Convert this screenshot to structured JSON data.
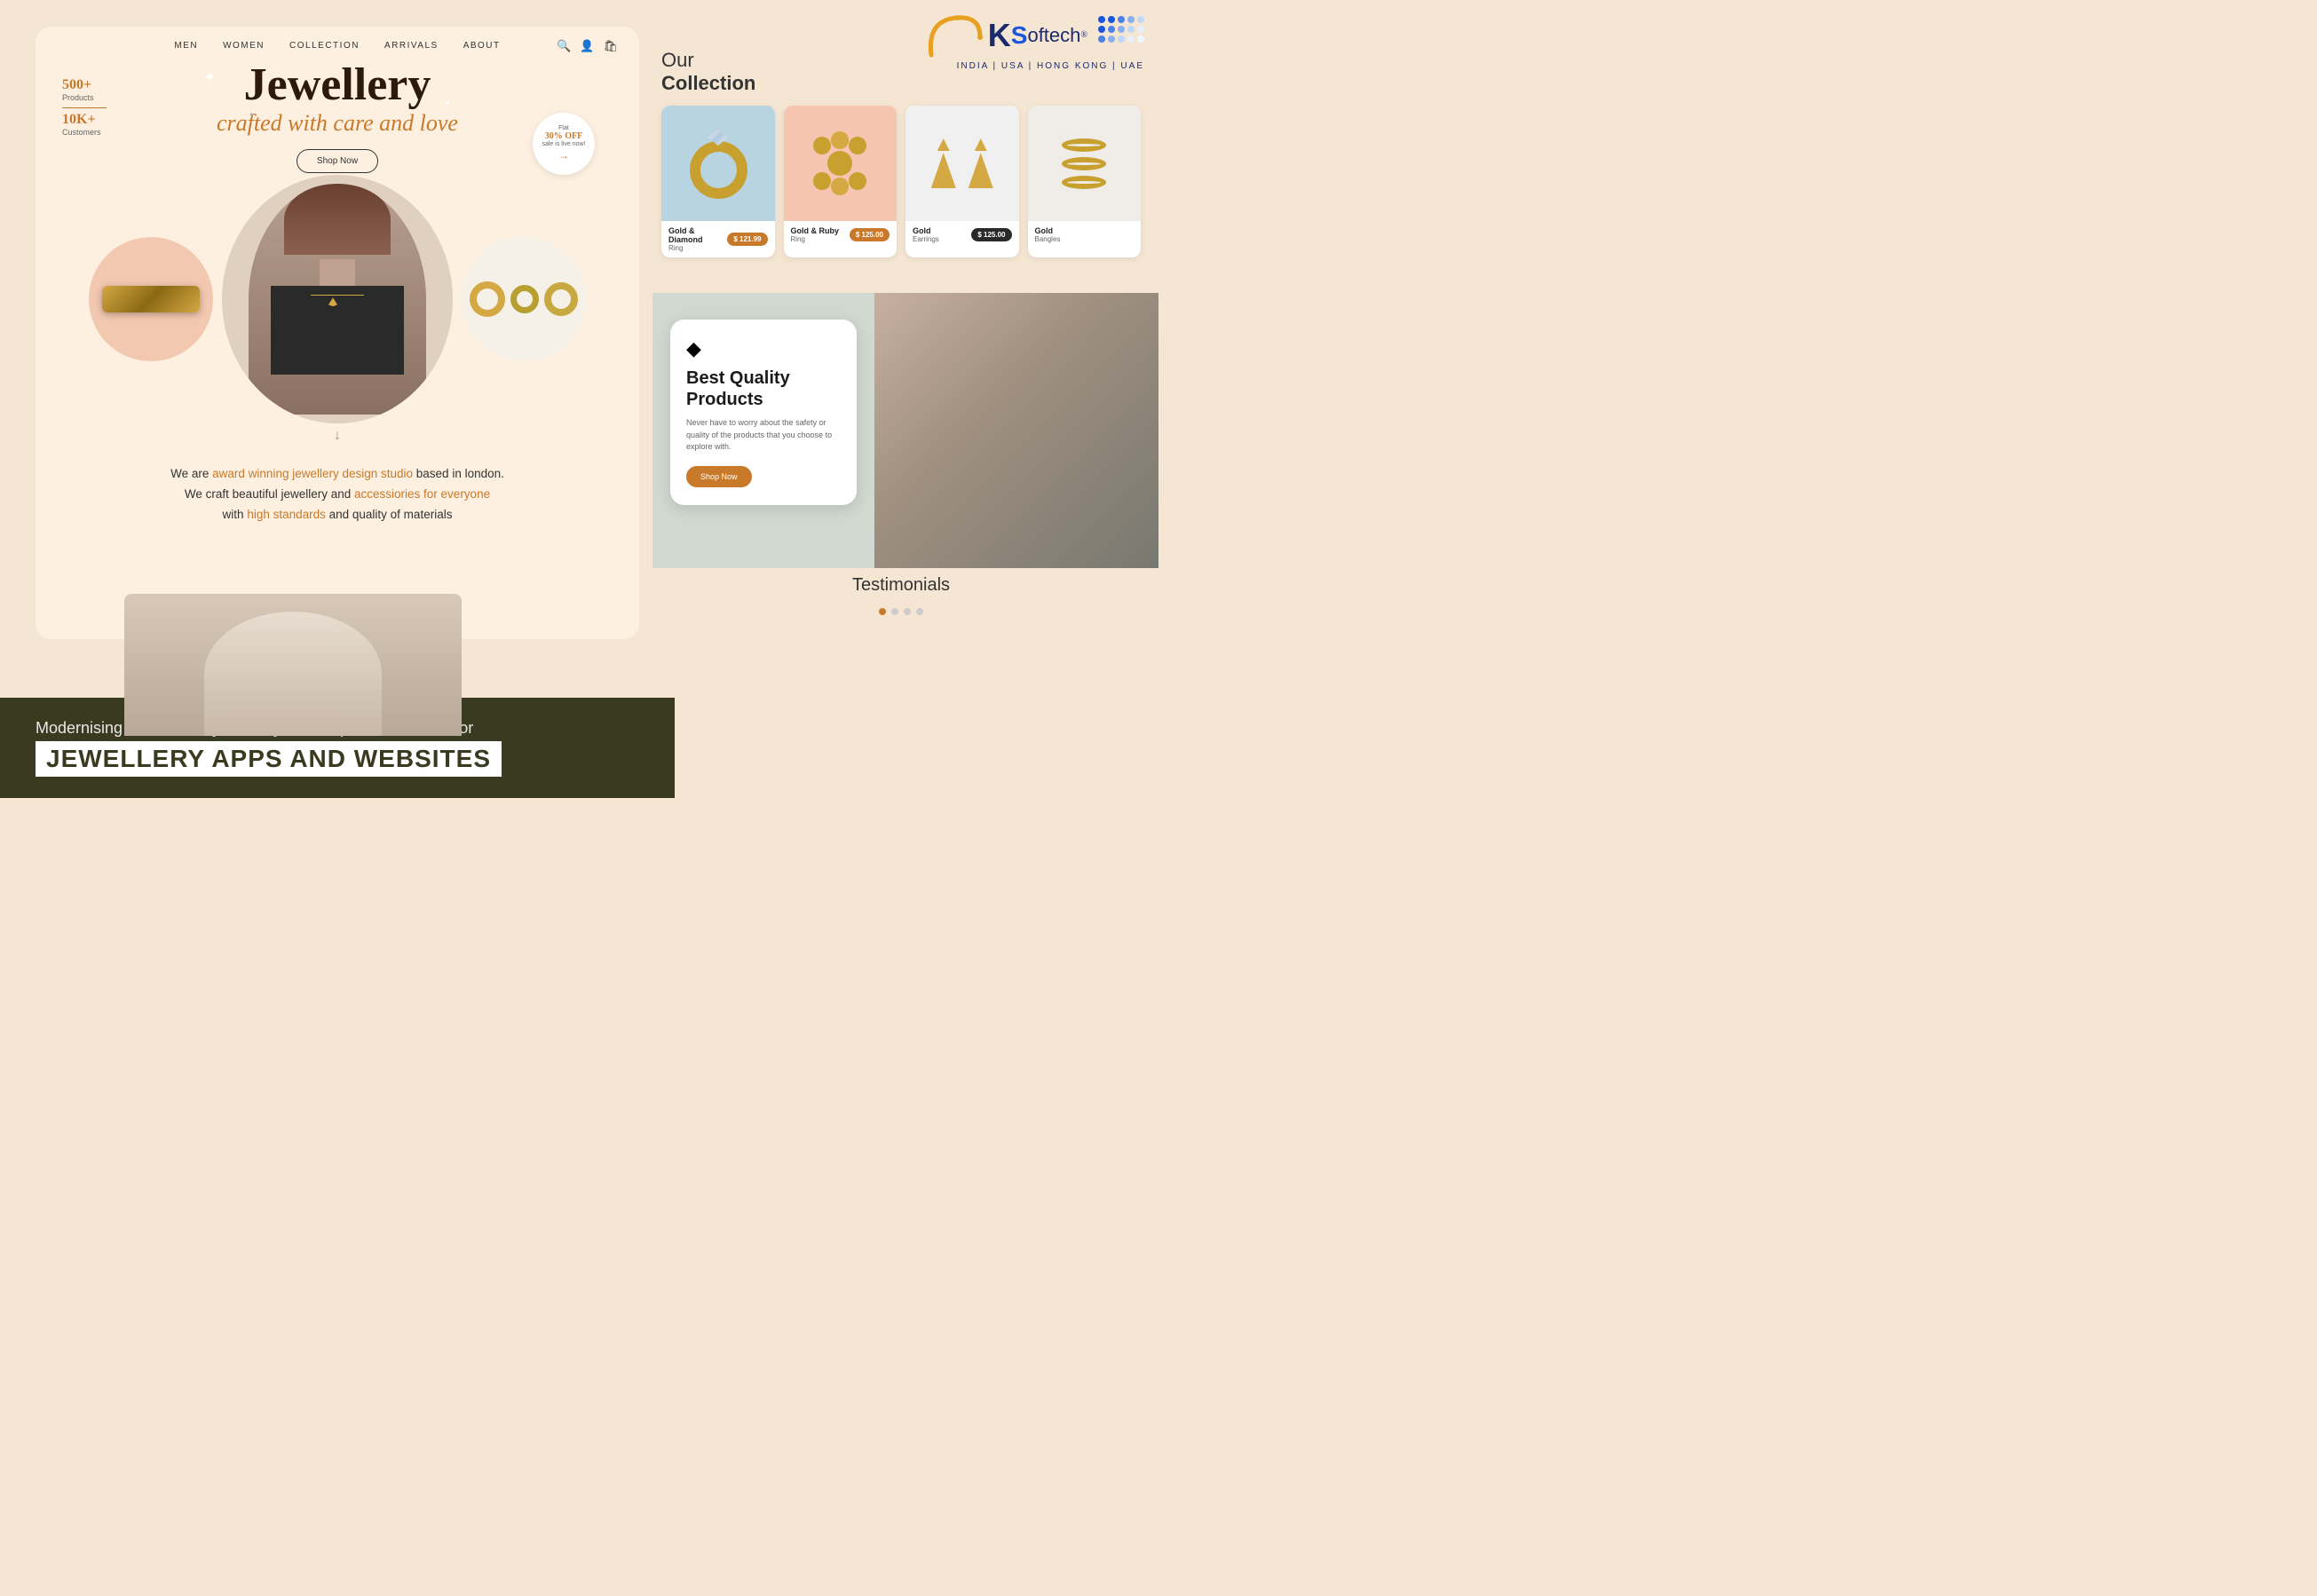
{
  "left_panel": {
    "nav": {
      "items": [
        "MEN",
        "WOMEN",
        "COLLECTION",
        "ARRIVALS",
        "ABOUT"
      ]
    },
    "hero": {
      "title": "Jewellery",
      "subtitle": "crafted with care and love",
      "shop_button": "Shop Now",
      "sale_flat": "Flat",
      "sale_pct": "30% OFF",
      "sale_live": "sale is live now!"
    },
    "stats": [
      {
        "number": "500+",
        "label": "Products"
      },
      {
        "number": "10K+",
        "label": "Customers"
      }
    ],
    "description": {
      "line1_start": "We are ",
      "line1_highlight": "award winning jewellery design studio",
      "line1_end": " based in london.",
      "line2_start": "We craft beautiful jewellery and ",
      "line2_highlight": "accessiories for everyone",
      "line3_start": "with ",
      "line3_highlight": "high standards",
      "line3_end": " and quality of materials"
    }
  },
  "right_panel": {
    "logo": {
      "brand_k": "K",
      "brand_s": "softech",
      "registered": "®",
      "tagline": "INDIA | USA | HONG KONG | UAE"
    },
    "collection": {
      "title_line1": "Our",
      "title_line2": "Collection",
      "cards": [
        {
          "name": "Gold & Diamond",
          "type": "Ring",
          "price": "$ 121.99",
          "price_badge_dark": false
        },
        {
          "name": "Gold & Ruby",
          "type": "Ring",
          "price": "$ 125.00",
          "price_badge_dark": false
        },
        {
          "name": "Gold",
          "type": "Earrings",
          "price": "$ 125.00",
          "price_badge_dark": true
        },
        {
          "name": "Gold",
          "type": "Bangles",
          "price": "",
          "price_badge_dark": true,
          "partial": true
        }
      ]
    },
    "quality": {
      "title": "Best Quality Products",
      "description": "Never have to worry about the safety or quality of the products that you choose to explore with.",
      "button": "Shop Now"
    },
    "testimonials": {
      "title": "Testimonials",
      "dots": [
        true,
        false,
        false,
        false
      ]
    }
  },
  "bottom_banner": {
    "subtitle": "Modernising the Jewellery Industry: Development Services for",
    "title": "JEWELLERY APPS AND WEBSITES"
  }
}
